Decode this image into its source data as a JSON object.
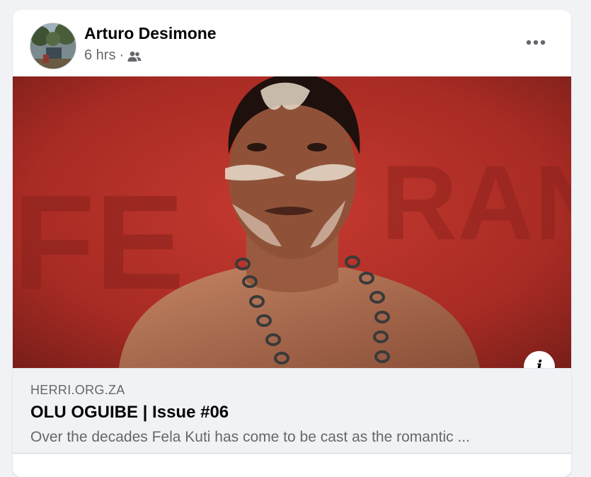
{
  "post": {
    "author": "Arturo Desimone",
    "time": "6 hrs",
    "separator": "·",
    "audience_icon": "friends-icon",
    "more_icon": "more-horizontal-icon"
  },
  "link_preview": {
    "domain": "HERRI.ORG.ZA",
    "title": "OLU OGUIBE | Issue #06",
    "description": "Over the decades Fela Kuti has come to be cast as the romantic ...",
    "info_icon": "i"
  },
  "colors": {
    "background": "#f0f2f5",
    "card": "#ffffff",
    "text_primary": "#050505",
    "text_secondary": "#65676b",
    "photo_red": "#b8312a"
  }
}
